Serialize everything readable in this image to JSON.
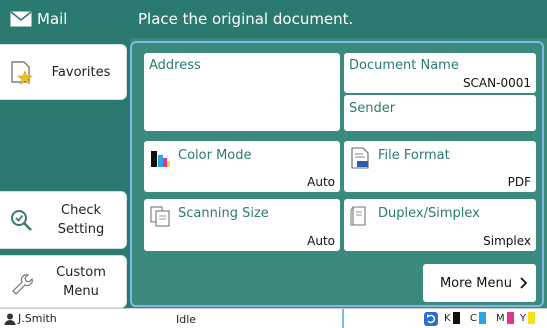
{
  "app": {
    "title": "Mail"
  },
  "header": {
    "message": "Place the original document."
  },
  "sidebar": {
    "favorites": "Favorites",
    "check_setting_line1": "Check",
    "check_setting_line2": "Setting",
    "custom_menu_line1": "Custom",
    "custom_menu_line2": "Menu"
  },
  "settings": {
    "address": {
      "label": "Address"
    },
    "document_name": {
      "label": "Document Name",
      "value": "SCAN-0001"
    },
    "sender": {
      "label": "Sender"
    },
    "color_mode": {
      "label": "Color Mode",
      "value": "Auto"
    },
    "file_format": {
      "label": "File Format",
      "value": "PDF"
    },
    "scanning_size": {
      "label": "Scanning Size",
      "value": "Auto"
    },
    "duplex_simplex": {
      "label": "Duplex/Simplex",
      "value": "Simplex"
    }
  },
  "more_menu": {
    "label": "More Menu"
  },
  "status_bar": {
    "user": "J.Smith",
    "state": "Idle",
    "inks": [
      {
        "letter": "K",
        "color": "#111111"
      },
      {
        "letter": "C",
        "color": "#2aa6e0"
      },
      {
        "letter": "M",
        "color": "#e0368f"
      },
      {
        "letter": "Y",
        "color": "#f3e11a"
      }
    ]
  },
  "colors": {
    "brand": "#2b7a6f",
    "panel": "#3a8a7e",
    "focus": "#7fb8e6",
    "label_text": "#2b7a6f"
  }
}
